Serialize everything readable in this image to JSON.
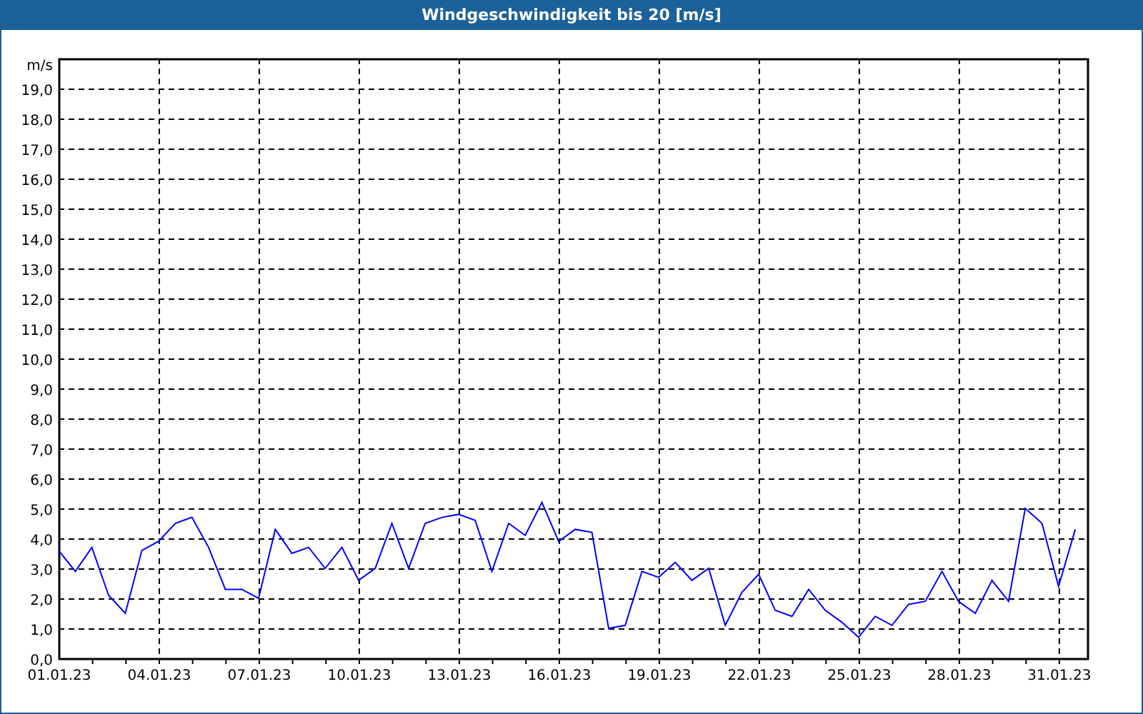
{
  "window": {
    "title": "Windgeschwindigkeit bis 20 [m/s]"
  },
  "chart": {
    "chart_data": {
      "type": "line",
      "grid": true,
      "ylabel": "m/s",
      "ylim": [
        0,
        20
      ],
      "yticks": [
        {
          "value": 0,
          "label": "0,0"
        },
        {
          "value": 1,
          "label": "1,0"
        },
        {
          "value": 2,
          "label": "2,0"
        },
        {
          "value": 3,
          "label": "3,0"
        },
        {
          "value": 4,
          "label": "4,0"
        },
        {
          "value": 5,
          "label": "5,0"
        },
        {
          "value": 6,
          "label": "6,0"
        },
        {
          "value": 7,
          "label": "7,0"
        },
        {
          "value": 8,
          "label": "8,0"
        },
        {
          "value": 9,
          "label": "9,0"
        },
        {
          "value": 10,
          "label": "10,0"
        },
        {
          "value": 11,
          "label": "11,0"
        },
        {
          "value": 12,
          "label": "12,0"
        },
        {
          "value": 13,
          "label": "13,0"
        },
        {
          "value": 14,
          "label": "14,0"
        },
        {
          "value": 15,
          "label": "15,0"
        },
        {
          "value": 16,
          "label": "16,0"
        },
        {
          "value": 17,
          "label": "17,0"
        },
        {
          "value": 18,
          "label": "18,0"
        },
        {
          "value": 19,
          "label": "19,0"
        }
      ],
      "categories": [
        "01.01.23",
        null,
        null,
        null,
        null,
        null,
        "04.01.23",
        null,
        null,
        null,
        null,
        null,
        "07.01.23",
        null,
        null,
        null,
        null,
        null,
        "10.01.23",
        null,
        null,
        null,
        null,
        null,
        "13.01.23",
        null,
        null,
        null,
        null,
        null,
        "16.01.23",
        null,
        null,
        null,
        null,
        null,
        "19.01.23",
        null,
        null,
        null,
        null,
        null,
        "22.01.23",
        null,
        null,
        null,
        null,
        null,
        "25.01.23",
        null,
        null,
        null,
        null,
        null,
        "28.01.23",
        null,
        null,
        null,
        null,
        null,
        "31.01.23",
        null
      ],
      "series": [
        {
          "color": "#0000ff",
          "values": [
            3.6,
            2.9,
            3.7,
            2.1,
            1.5,
            3.6,
            3.9,
            4.5,
            4.7,
            3.7,
            2.3,
            2.3,
            2.0,
            4.3,
            3.5,
            3.7,
            3.0,
            3.7,
            2.6,
            3.0,
            4.5,
            3.0,
            4.5,
            4.7,
            4.8,
            4.6,
            2.9,
            4.5,
            4.1,
            5.2,
            3.9,
            4.3,
            4.2,
            1.0,
            1.1,
            2.9,
            2.7,
            3.2,
            2.6,
            3.0,
            1.1,
            2.2,
            2.8,
            1.6,
            1.4,
            2.3,
            1.6,
            1.2,
            0.7,
            1.4,
            1.1,
            1.8,
            1.9,
            2.9,
            1.9,
            1.5,
            2.6,
            1.9,
            5.0,
            4.5,
            2.4,
            4.3
          ]
        }
      ]
    }
  }
}
